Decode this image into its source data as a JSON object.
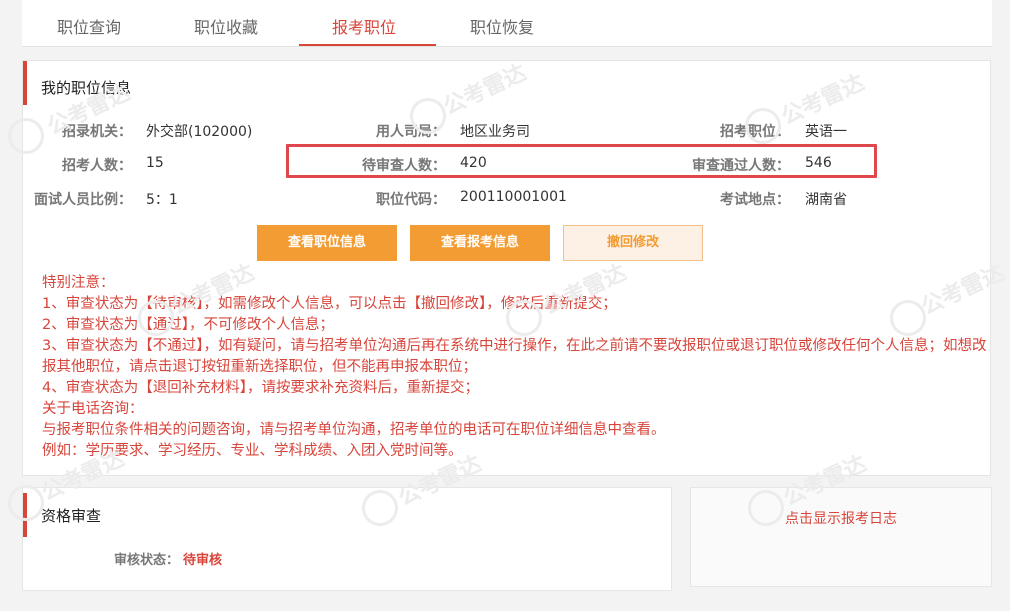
{
  "tabs": [
    "职位查询",
    "职位收藏",
    "报考职位",
    "职位恢复"
  ],
  "position_info": {
    "title": "我的职位信息",
    "rows": [
      [
        {
          "label": "招录机关：",
          "value": "外交部(102000)"
        },
        {
          "label": "用人司局：",
          "value": "地区业务司"
        },
        {
          "label": "招考职位：",
          "value": "英语一"
        }
      ],
      [
        {
          "label": "招考人数：",
          "value": "15"
        },
        {
          "label": "待审查人数：",
          "value": "420"
        },
        {
          "label": "审查通过人数：",
          "value": "546"
        }
      ],
      [
        {
          "label": "面试人员比例：",
          "value": "5：1"
        },
        {
          "label": "职位代码：",
          "value": "200110001001"
        },
        {
          "label": "考试地点：",
          "value": "湖南省"
        }
      ]
    ]
  },
  "buttons": {
    "view_position": "查看职位信息",
    "view_application": "查看报考信息",
    "revoke_edit": "撤回修改"
  },
  "notice": [
    "特别注意：",
    "1、审查状态为【待审核】，如需修改个人信息，可以点击【撤回修改】，修改后重新提交；",
    "2、审查状态为【通过】，不可修改个人信息；",
    "3、审查状态为【不通过】，如有疑问，请与招考单位沟通后再在系统中进行操作，在此之前请不要改报职位或退订职位或修改任何个人信息；如想改报其他职位，请点击退订按钮重新选择职位，但不能再申报本职位；",
    "4、审查状态为【退回补充材料】，请按要求补充资料后，重新提交；",
    "关于电话咨询：",
    "与报考职位条件相关的问题咨询，请与招考单位沟通，招考单位的电话可在职位详细信息中查看。",
    "例如：学历要求、学习经历、专业、学科成绩、入团入党时间等。"
  ],
  "qualification": {
    "title": "资格审查",
    "status_label": "审核状态：",
    "status_value": "待审核"
  },
  "log_link": "点击显示报考日志",
  "watermark": {
    "cn": "公考雷达",
    "en": "GONGKAOLEIDA"
  },
  "colors": {
    "accent": "#d8453b",
    "button": "#f39c33",
    "highlight": "#e0474c"
  }
}
